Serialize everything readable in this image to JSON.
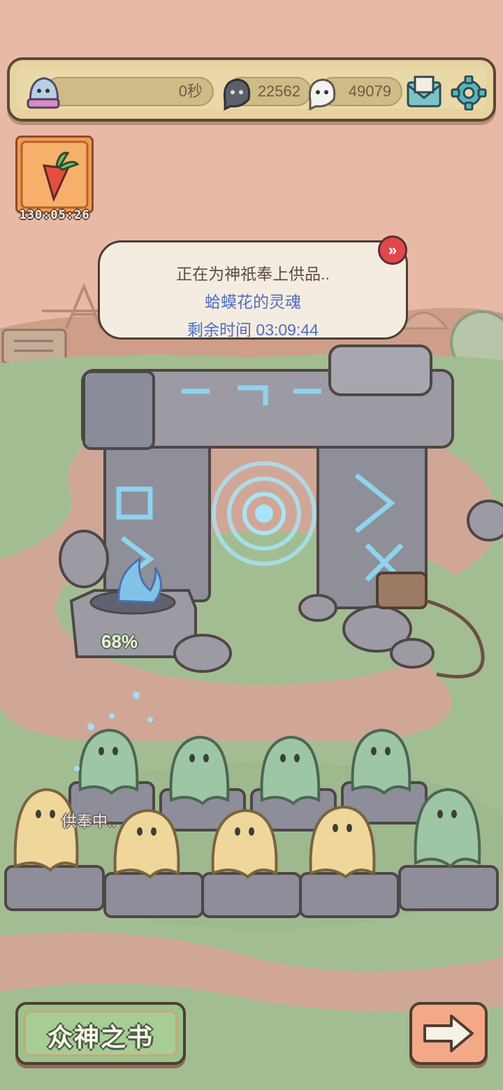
{
  "top_bar": {
    "timer_value": "0秒",
    "soul_count_dark": "22562",
    "soul_count_light": "49079",
    "icons": [
      "ghost-avatar-icon",
      "dark-soul-icon",
      "light-soul-icon",
      "mail-icon",
      "gear-icon"
    ]
  },
  "event": {
    "countdown": "130:05:26",
    "icon": "carrot-card-icon"
  },
  "bubble": {
    "line1": "正在为神祇奉上供品..",
    "line2": "蛤蟆花的灵魂",
    "line3": "剩余时间  03:09:44",
    "fast_forward_icon": "fast-forward-icon"
  },
  "altar": {
    "progress_text": "68%",
    "progress": 0.68
  },
  "ghosts": {
    "offering_label": "供奉中.."
  },
  "bottom": {
    "book_label": "众神之书",
    "next_icon": "arrow-right-icon"
  },
  "colors": {
    "sky": "#e9b9a7",
    "grass": "#a3bd93",
    "path": "#d8a398",
    "rune_blue": "#8fd3ee",
    "ghost_green": "#9cc6a4",
    "ghost_yellow": "#efd79b"
  }
}
